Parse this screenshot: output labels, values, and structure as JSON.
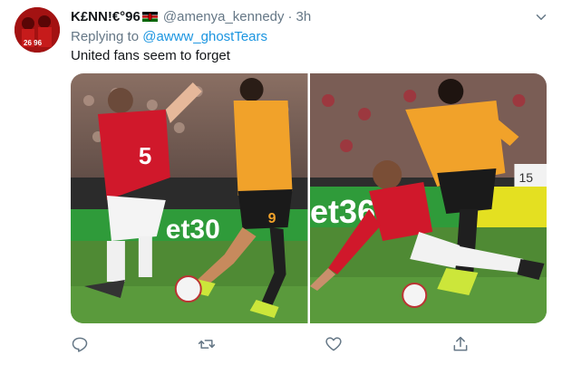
{
  "tweet": {
    "display_name": "K£NN!€°96",
    "handle": "@amenya_kennedy",
    "separator": "·",
    "time": "3h",
    "reply_prefix": "Replying to",
    "reply_to": "@awww_ghostTears",
    "text": "United fans seem to forget",
    "avatar_numbers": "26 96"
  },
  "media": {
    "left_photo": {
      "description_kind": "football-photo",
      "shirt_number_red": "5",
      "shirt_number_orange": "9",
      "board_text": "et30"
    },
    "right_photo": {
      "description_kind": "football-photo",
      "board_text": "et36",
      "side_number": "15"
    }
  },
  "actions": [
    "reply-icon",
    "retweet-icon",
    "like-icon",
    "share-icon"
  ],
  "colors": {
    "link": "#1b95e0",
    "muted": "#657786",
    "pitch": "#4f8a34",
    "united_red": "#d0182b",
    "wolves_orange": "#f1a22a"
  }
}
